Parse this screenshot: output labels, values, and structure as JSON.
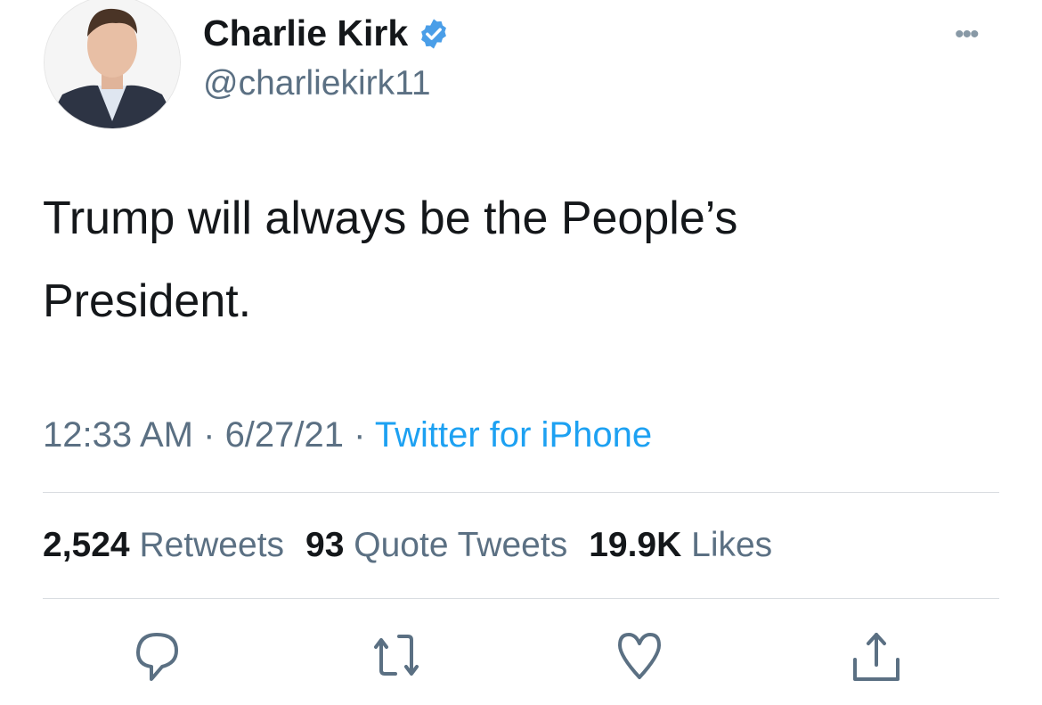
{
  "author": {
    "name": "Charlie Kirk",
    "handle": "@charliekirk11",
    "verified": true
  },
  "tweet": {
    "lines": [
      "Trump will always be the People’s",
      "President."
    ]
  },
  "meta": {
    "time": "12:33 AM",
    "sep1": " · ",
    "date": "6/27/21",
    "sep2": " · ",
    "source": "Twitter for iPhone"
  },
  "stats": {
    "retweets": {
      "count": "2,524",
      "label": "Retweets"
    },
    "quotes": {
      "count": "93",
      "label": "Quote Tweets"
    },
    "likes": {
      "count": "19.9K",
      "label": "Likes"
    }
  },
  "more_label": "•••",
  "actions": [
    "reply-icon",
    "retweet-icon",
    "like-icon",
    "share-icon"
  ],
  "colors": {
    "accent": "#1da1f2",
    "secondary": "#5b7083",
    "verified": "#4a9ee8"
  }
}
